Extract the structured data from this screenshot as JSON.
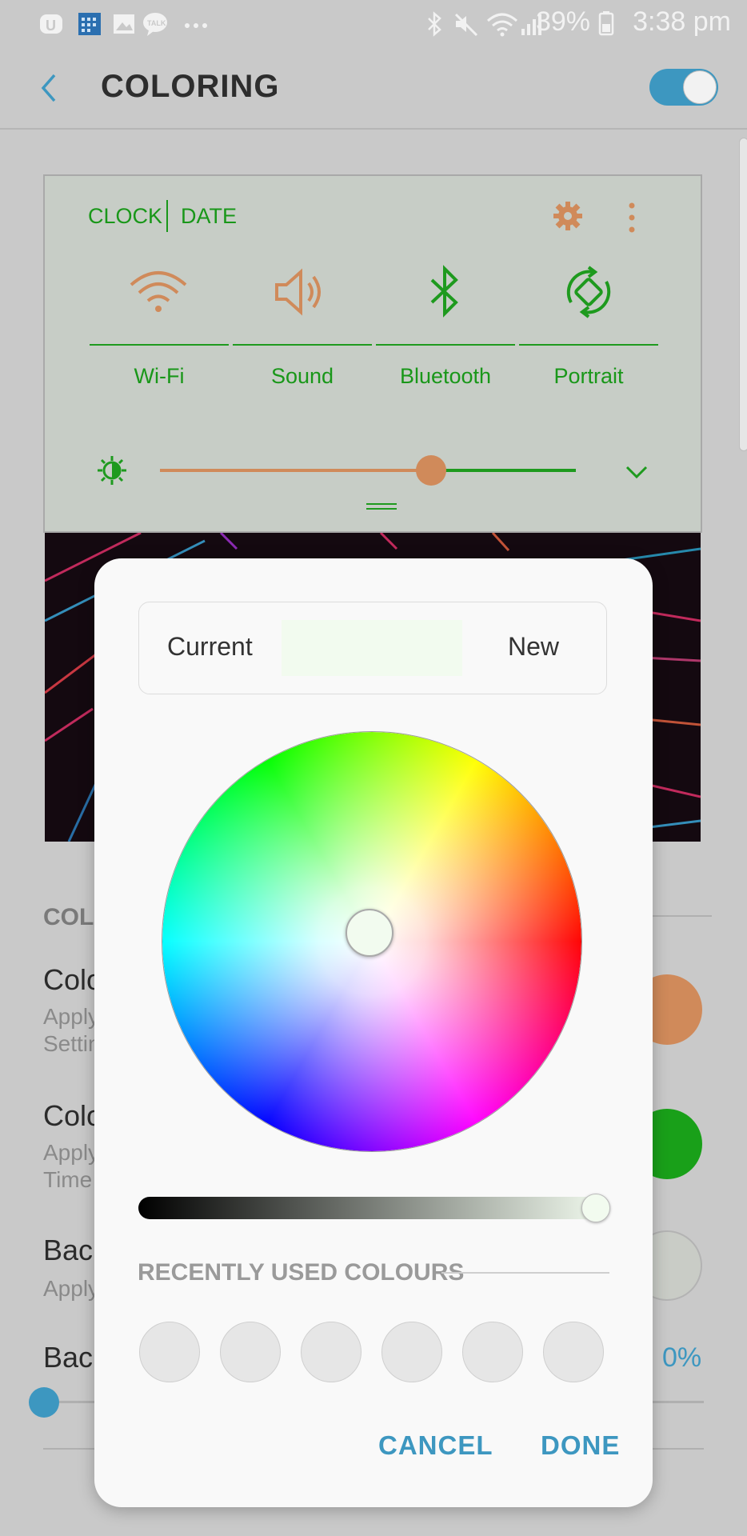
{
  "status_bar": {
    "battery": "39%",
    "time": "3:38 pm",
    "icons": [
      "samsung-pass-icon",
      "calendar-icon",
      "gallery-icon",
      "talk-icon",
      "more-dots-icon",
      "bluetooth-icon",
      "mute-icon",
      "wifi-icon",
      "signal-icon",
      "battery-icon"
    ]
  },
  "app_bar": {
    "title": "COLORING",
    "toggle_on": true
  },
  "preview": {
    "clock": "CLOCK",
    "date": "DATE",
    "tiles": [
      {
        "label": "Wi-Fi",
        "icon": "wifi-icon"
      },
      {
        "label": "Sound",
        "icon": "sound-icon"
      },
      {
        "label": "Bluetooth",
        "icon": "bluetooth-icon"
      },
      {
        "label": "Portrait",
        "icon": "rotate-icon"
      }
    ],
    "brightness_level": 0.67,
    "colors": {
      "accent": "#199719",
      "icon": "#d08a5a",
      "background": "#c7cdc6"
    }
  },
  "settings": {
    "section_label": "COLO",
    "items": [
      {
        "title": "Colo",
        "sub": "Apply\nSettin",
        "swatch": "#d08a5a"
      },
      {
        "title": "Colo",
        "sub": "Apply\nTime",
        "swatch": "#19a019"
      },
      {
        "title": "Bac",
        "sub": "Apply",
        "swatch": "#c9ccc6"
      },
      {
        "title": "Bac",
        "value": "0%"
      }
    ]
  },
  "dialog": {
    "current_label": "Current",
    "new_label": "New",
    "selected_color": "#f2fbef",
    "recent_label": "RECENTLY USED COLOURS",
    "recent_count": 6,
    "cancel": "CANCEL",
    "done": "DONE"
  }
}
